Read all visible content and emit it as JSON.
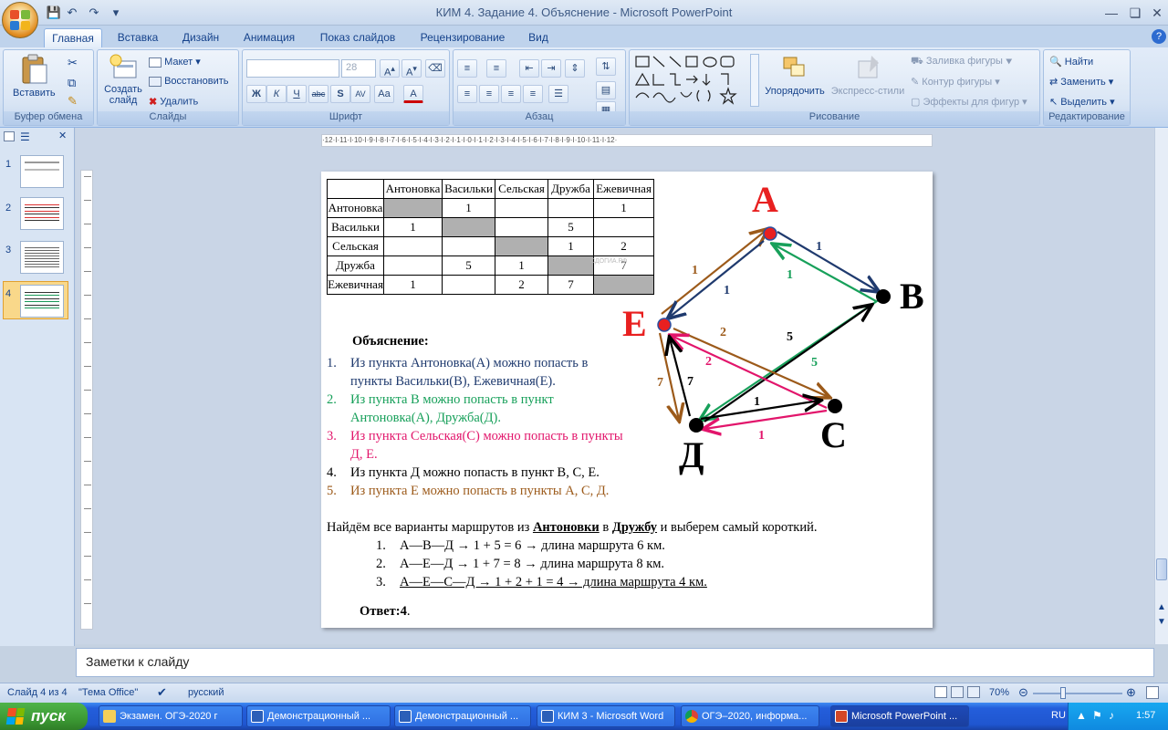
{
  "window": {
    "title": "КИМ 4. Задание 4. Объяснение - Microsoft PowerPoint"
  },
  "tabs": [
    "Главная",
    "Вставка",
    "Дизайн",
    "Анимация",
    "Показ слайдов",
    "Рецензирование",
    "Вид"
  ],
  "ribbon": {
    "clipboard": {
      "paste": "Вставить",
      "label": "Буфер обмена"
    },
    "slides": {
      "create": "Создать",
      "create2": "слайд",
      "layout": "Макет",
      "reset": "Восстановить",
      "delete": "Удалить",
      "label": "Слайды"
    },
    "font": {
      "size": "28",
      "label": "Шрифт"
    },
    "paragraph": {
      "label": "Абзац"
    },
    "drawing": {
      "arrange": "Упорядочить",
      "quickstyles": "Экспресс-стили",
      "fill": "Заливка фигуры",
      "outline": "Контур фигуры",
      "effects": "Эффекты для фигур",
      "label": "Рисование"
    },
    "editing": {
      "find": "Найти",
      "replace": "Заменить",
      "select": "Выделить",
      "label": "Редактирование"
    }
  },
  "thumbnails": [
    "1",
    "2",
    "3",
    "4"
  ],
  "ruler": "·12·I·11·I·10·I·9·I·8·I·7·I·6·I·5·I·4·I·3·I·2·I·1·I·0·I·1·I·2·I·3·I·4·I·5·I·6·I·7·I·8·I·9·I·10·I·11·I·12·",
  "slide": {
    "table": {
      "headers": [
        "",
        "Антоновка",
        "Васильки",
        "Сельская",
        "Дружба",
        "Ежевичная"
      ],
      "rows": [
        [
          "Антоновка",
          "",
          "1",
          "",
          "",
          "1"
        ],
        [
          "Васильки",
          "1",
          "",
          "",
          "5",
          ""
        ],
        [
          "Сельская",
          "",
          "",
          "",
          "1",
          "2"
        ],
        [
          "Дружба",
          "",
          "5",
          "1",
          "",
          "7"
        ],
        [
          "Ежевичная",
          "1",
          "",
          "2",
          "7",
          ""
        ]
      ],
      "watermark": "СДОГИА.РФ"
    },
    "explanation_title": "Объяснение:",
    "items": [
      {
        "n": "1.",
        "l1": "Из пункта Антоновка(А) можно попасть в",
        "l2": "пункты Васильки(В), Ежевичная(Е).",
        "color": "#1f3a6e"
      },
      {
        "n": "2.",
        "l1": "Из пункта В можно попасть в пункт",
        "l2": "Антоновка(А), Дружба(Д).",
        "color": "#17a05a"
      },
      {
        "n": "3.",
        "l1": "Из пункта Сельская(С) можно попасть в пункты",
        "l2": "Д, Е.",
        "color": "#e2156b"
      },
      {
        "n": "4.",
        "l1": "Из пункта Д можно попасть в пункт В, С, Е.",
        "l2": "",
        "color": "#000000"
      },
      {
        "n": "5.",
        "l1": "Из пункта Е можно попасть в пункты А, С, Д.",
        "l2": "",
        "color": "#9c5a1a"
      }
    ],
    "routes_intro": "Найдём все варианты маршрутов из Антоновки в Дружбу и выберем самый короткий.",
    "routes": [
      {
        "n": "1.",
        "text": "А—В—Д → 1 + 5 = 6 → длина маршрута 6 км."
      },
      {
        "n": "2.",
        "text": "А—Е—Д → 1 + 7 = 8 → длина маршрута 8 км."
      },
      {
        "n": "3.",
        "text": "А—Е—С—Д → 1 + 2 + 1 = 4 → длина маршрута 4 км."
      }
    ],
    "answer_label": "Ответ:",
    "answer_value": "4",
    "graph": {
      "nodes": {
        "A": "А",
        "B": "В",
        "E": "Е",
        "C": "С",
        "D": "Д"
      },
      "weights": {
        "ea": "1",
        "ae": "1",
        "ab": "1",
        "ba": "1",
        "ce": "2",
        "ec": "2",
        "db": "5",
        "bd": "5",
        "ed": "7",
        "de": "7",
        "dc": "1",
        "cd": "1"
      }
    }
  },
  "notes": "Заметки к слайду",
  "status": {
    "slide": "Слайд 4 из 4",
    "theme": "\"Тема Office\"",
    "lang": "русский",
    "zoom": "70%"
  },
  "taskbar": {
    "start": "пуск",
    "tasks": [
      "Экзамен. ОГЭ-2020 г",
      "Демонстрационный ...",
      "Демонстрационный ...",
      "КИМ 3 - Microsoft Word",
      "ОГЭ–2020, информа...",
      "Microsoft PowerPoint ..."
    ],
    "lang": "RU",
    "time": "1:57"
  },
  "colors": {
    "ribbon": "#dbe7f6",
    "taskbar": "#245edb",
    "start": "#3c9a34"
  }
}
